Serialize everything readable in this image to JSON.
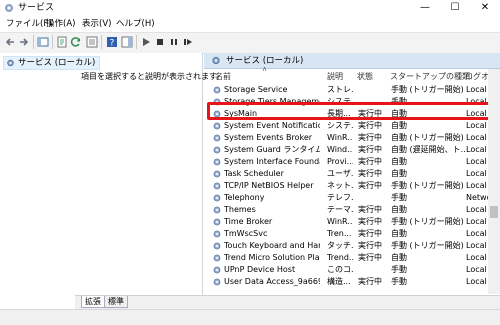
{
  "window": {
    "title": "サービス"
  },
  "menu": [
    "ファイル(F)",
    "操作(A)",
    "表示(V)",
    "ヘルプ(H)"
  ],
  "tree": {
    "root": "サービス (ローカル)"
  },
  "pane": {
    "header": "サービス (ローカル)",
    "description_prompt": "項目を選択すると説明が表示されます。"
  },
  "columns": {
    "name": "名前",
    "desc": "説明",
    "status": "状態",
    "startup": "スタートアップの種類",
    "logon": "ログオン"
  },
  "services": [
    {
      "name": "Storage Service",
      "desc": "ストレ...",
      "status": "",
      "startup": "手動 (トリガー開始)",
      "logon": "Local S"
    },
    {
      "name": "Storage Tiers Management",
      "desc": "システ...",
      "status": "",
      "startup": "手動",
      "logon": "Local S"
    },
    {
      "name": "SysMain",
      "desc": "長期...",
      "status": "実行中",
      "startup": "自動",
      "logon": "Local S"
    },
    {
      "name": "System Event Notification S...",
      "desc": "システ...",
      "status": "実行中",
      "startup": "自動",
      "logon": "Local S"
    },
    {
      "name": "System Events Broker",
      "desc": "WinR...",
      "status": "実行中",
      "startup": "自動 (トリガー開始)",
      "logon": "Local S"
    },
    {
      "name": "System Guard ランタイム モニタ...",
      "desc": "Wind...",
      "status": "実行中",
      "startup": "自動 (遅延開始、ト...",
      "logon": "Local S"
    },
    {
      "name": "System Interface Foundatio...",
      "desc": "Provi...",
      "status": "実行中",
      "startup": "自動",
      "logon": "Local S"
    },
    {
      "name": "Task Scheduler",
      "desc": "ユーザ...",
      "status": "実行中",
      "startup": "自動",
      "logon": "Local S"
    },
    {
      "name": "TCP/IP NetBIOS Helper",
      "desc": "ネット...",
      "status": "実行中",
      "startup": "手動 (トリガー開始)",
      "logon": "Local S"
    },
    {
      "name": "Telephony",
      "desc": "テレフ...",
      "status": "",
      "startup": "手動",
      "logon": "Networ"
    },
    {
      "name": "Themes",
      "desc": "テーマ...",
      "status": "実行中",
      "startup": "自動",
      "logon": "Local S"
    },
    {
      "name": "Time Broker",
      "desc": "WinR...",
      "status": "実行中",
      "startup": "手動 (トリガー開始)",
      "logon": "Local S"
    },
    {
      "name": "TmWscSvc",
      "desc": "Tren...",
      "status": "実行中",
      "startup": "自動",
      "logon": "Local S"
    },
    {
      "name": "Touch Keyboard and Hand...",
      "desc": "タッチ...",
      "status": "実行中",
      "startup": "手動 (トリガー開始)",
      "logon": "Local S"
    },
    {
      "name": "Trend Micro Solution Platfo...",
      "desc": "Trend...",
      "status": "実行中",
      "startup": "自動",
      "logon": "Local S"
    },
    {
      "name": "UPnP Device Host",
      "desc": "このコ...",
      "status": "",
      "startup": "手動",
      "logon": "Local S"
    },
    {
      "name": "User Data Access_9a669",
      "desc": "構造...",
      "status": "実行中",
      "startup": "手動",
      "logon": "Local S"
    }
  ],
  "tabs": [
    "拡張",
    "標準"
  ],
  "colors": {
    "highlight": "#e8141a",
    "header_bg": "#d8e6f3",
    "tree_selected": "#e5f1fb"
  }
}
